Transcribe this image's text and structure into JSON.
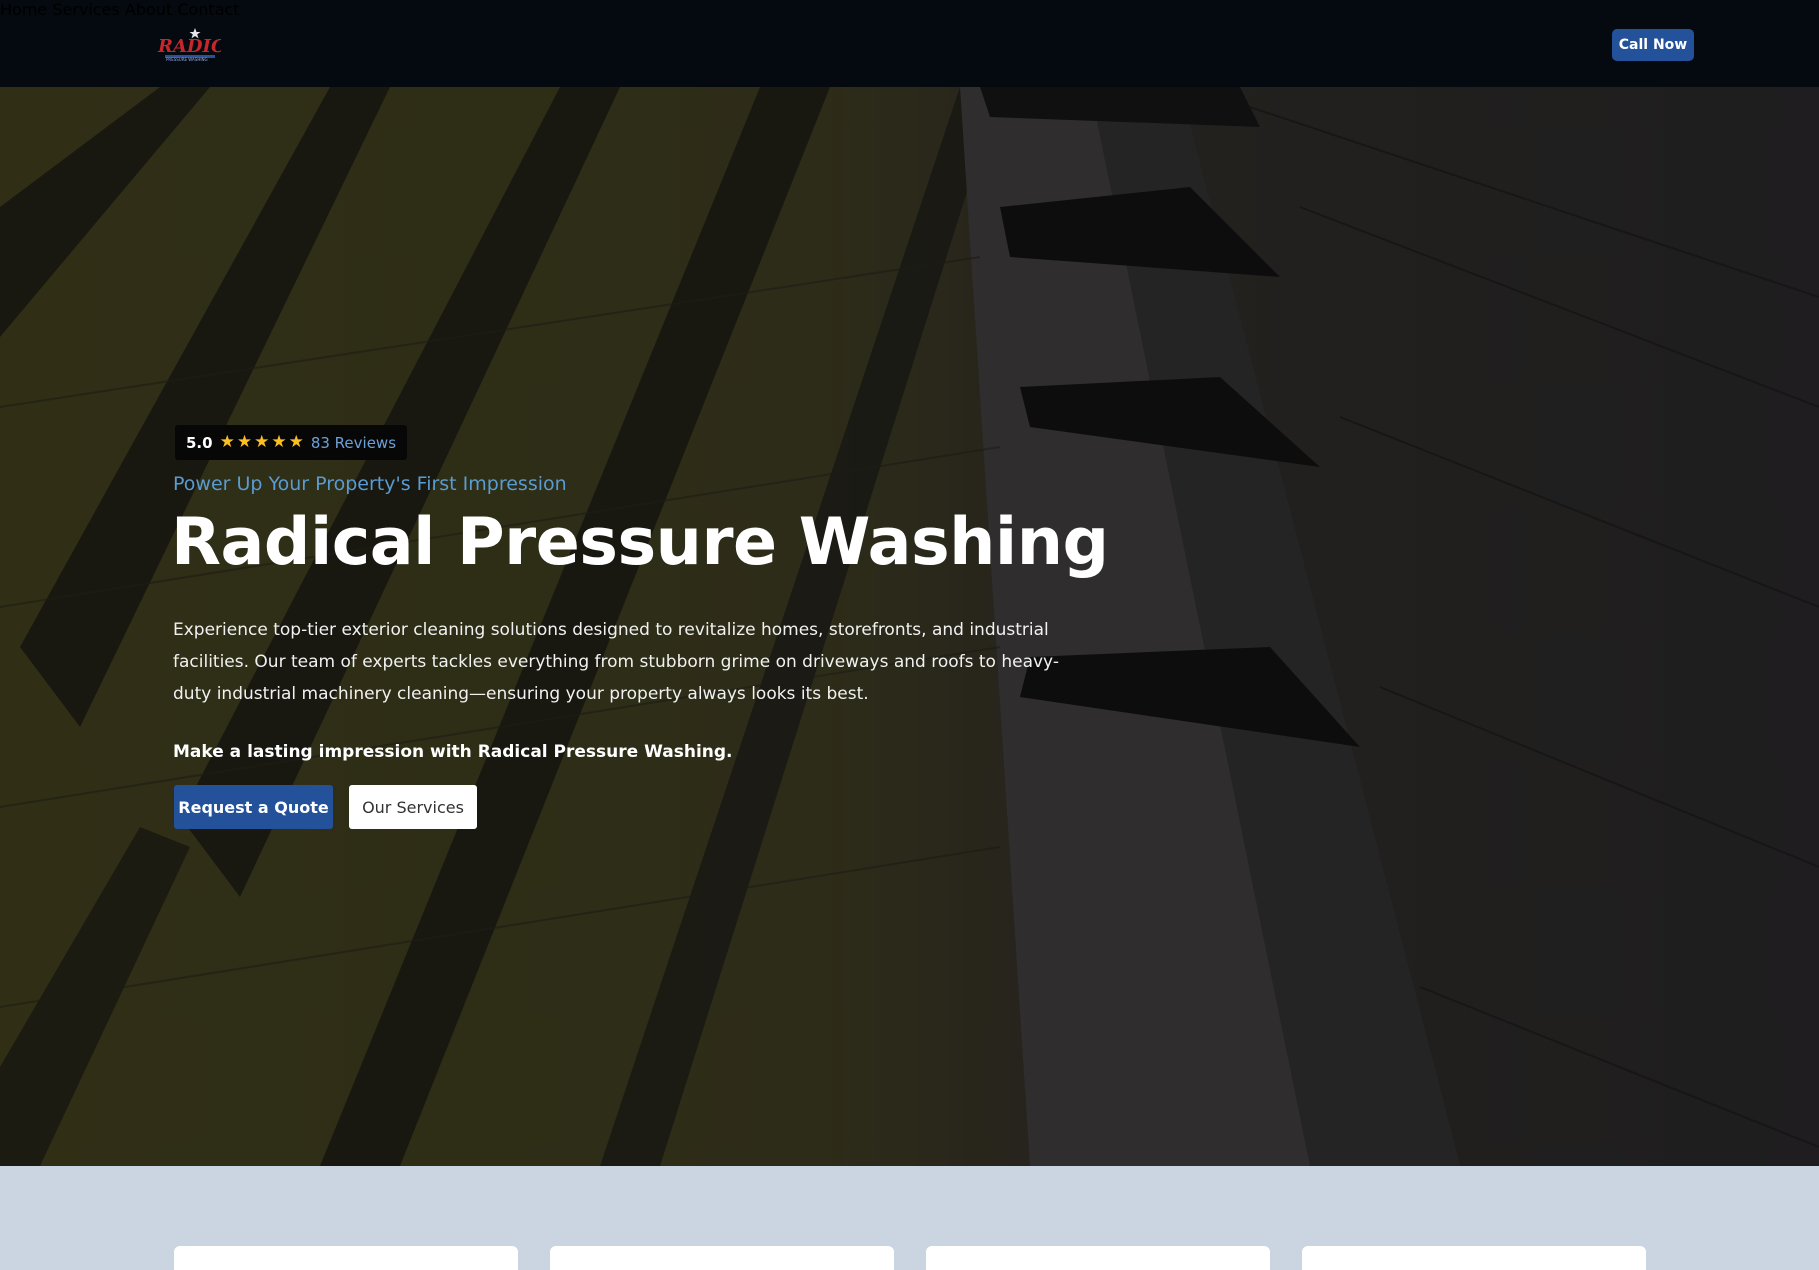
{
  "header": {
    "logo_text": "RADICAL",
    "logo_subtext": "PRESSURE WASHING",
    "nav": [
      {
        "label": "Home"
      },
      {
        "label": "Services"
      },
      {
        "label": "About"
      },
      {
        "label": "Contact"
      }
    ],
    "cta_label": "Call Now"
  },
  "hero": {
    "rating": {
      "score": "5.0",
      "stars": 5,
      "reviews": "83 Reviews"
    },
    "tagline": "Power Up Your Property's First Impression",
    "title": "Radical Pressure Washing",
    "description": "Experience top-tier exterior cleaning solutions designed to revitalize homes, storefronts, and industrial facilities. Our team of experts tackles everything from stubborn grime on driveways and roofs to heavy-duty industrial machinery cleaning—ensuring your property always looks its best.",
    "emphasis": "Make a lasting impression with Radical Pressure Washing.",
    "primary_button": "Request a Quote",
    "secondary_button": "Our Services"
  },
  "colors": {
    "header_bg": "#050a10",
    "accent_blue": "#23519a",
    "tagline_blue": "#5a9bd0",
    "star_yellow": "#fbbf24",
    "section_bg": "#cbd5e1"
  },
  "icons": {
    "star": "star-icon",
    "logo": "radical-logo"
  }
}
